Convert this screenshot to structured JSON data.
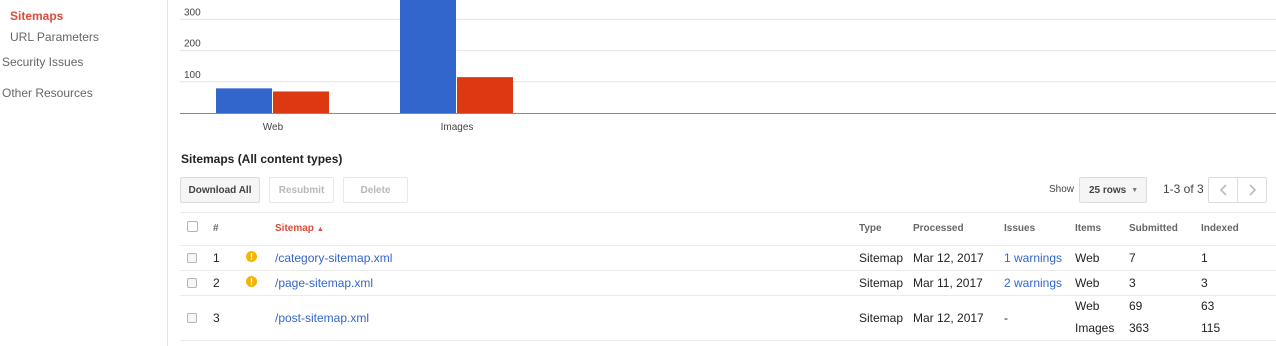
{
  "sidebar": {
    "active_item": "Sitemaps",
    "sub_item": "URL Parameters",
    "security": "Security Issues",
    "other": "Other Resources"
  },
  "chart_data": {
    "type": "bar",
    "categories": [
      "Web",
      "Images"
    ],
    "series": [
      {
        "values": [
          79,
          363
        ],
        "color": "#3366cc"
      },
      {
        "values": [
          69,
          115
        ],
        "color": "#dc3912"
      }
    ],
    "y_ticks": [
      "100",
      "200",
      "300",
      "400"
    ],
    "ylim": [
      0,
      400
    ],
    "grid": true,
    "title": "",
    "xlabel": "",
    "ylabel": ""
  },
  "section_title": "Sitemaps (All content types)",
  "toolbar": {
    "download_all": "Download All",
    "resubmit": "Resubmit",
    "delete": "Delete",
    "show_label": "Show",
    "rows_value": "25 rows",
    "pager_range": "1-3 of 3"
  },
  "table": {
    "headers": {
      "num": "#",
      "sitemap": "Sitemap",
      "type": "Type",
      "processed": "Processed",
      "issues": "Issues",
      "items": "Items",
      "submitted": "Submitted",
      "indexed": "Indexed"
    },
    "rows": [
      {
        "num": "1",
        "sitemap": "/category-sitemap.xml",
        "type": "Sitemap",
        "processed": "Mar 12, 2017",
        "issues": "1 warnings",
        "warning": true,
        "items": [
          {
            "item": "Web",
            "submitted": "7",
            "indexed": "1"
          }
        ]
      },
      {
        "num": "2",
        "sitemap": "/page-sitemap.xml",
        "type": "Sitemap",
        "processed": "Mar 11, 2017",
        "issues": "2 warnings",
        "warning": true,
        "items": [
          {
            "item": "Web",
            "submitted": "3",
            "indexed": "3"
          }
        ]
      },
      {
        "num": "3",
        "sitemap": "/post-sitemap.xml",
        "type": "Sitemap",
        "processed": "Mar 12, 2017",
        "issues": "-",
        "warning": false,
        "items": [
          {
            "item": "Web",
            "submitted": "69",
            "indexed": "63"
          },
          {
            "item": "Images",
            "submitted": "363",
            "indexed": "115"
          }
        ]
      }
    ]
  },
  "colors": {
    "accent_red": "#dd4b39",
    "link_blue": "#3366cc",
    "warning_orange": "#f4b400"
  }
}
